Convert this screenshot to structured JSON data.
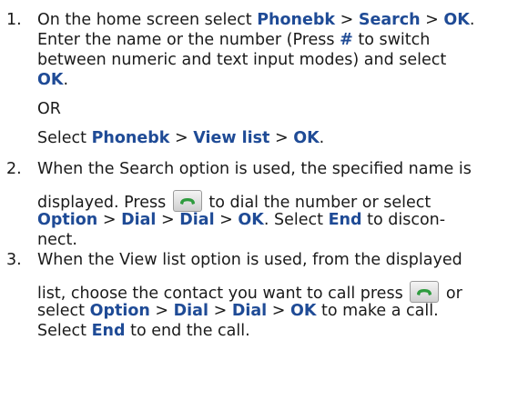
{
  "kw": {
    "phonebk": "Phonebk",
    "search": "Search",
    "ok": "OK",
    "hash": "#",
    "view_list": "View list",
    "option": "Option",
    "dial": "Dial",
    "end": "End"
  },
  "sep": ">",
  "steps": {
    "s1": {
      "number": "1.",
      "l1a": "On the home screen select",
      "l2a": "Enter the name or the number (Press",
      "l2b": "to switch",
      "l3": "between numeric and text input modes) and select",
      "l4b": ".",
      "or": "OR",
      "alt_a": "Select",
      "alt_end": "."
    },
    "s2": {
      "number": "2.",
      "l1": "When the Search option is used, the specified name is",
      "l2a": "displayed. Press",
      "l2b": "to dial the number or select",
      "l3a": "Select",
      "l3b": "to discon-",
      "l4": "nect."
    },
    "s3": {
      "number": "3.",
      "l1": "When the View list option is used, from the displayed",
      "l2a": "list, choose the contact you want to call press",
      "l2b": "or",
      "l3a": "select",
      "l3b": "to make a call.",
      "l4a": "Select",
      "l4b": "to end the call."
    }
  },
  "icon": "call-key-icon",
  "colors": {
    "keyword": "#1f4b96",
    "text": "#1a1a1a",
    "call_icon": "#2e9b3e"
  }
}
